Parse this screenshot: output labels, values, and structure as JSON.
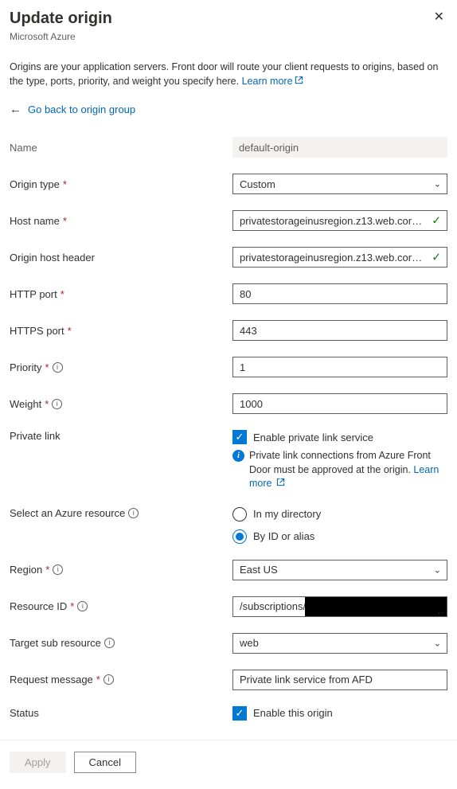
{
  "header": {
    "title": "Update origin",
    "subtitle": "Microsoft Azure"
  },
  "description": {
    "text": "Origins are your application servers. Front door will route your client requests to origins, based on the type, ports, priority, and weight you specify here.",
    "learn_more": "Learn more"
  },
  "back_link": "Go back to origin group",
  "fields": {
    "name": {
      "label": "Name",
      "value": "default-origin"
    },
    "origin_type": {
      "label": "Origin type",
      "value": "Custom"
    },
    "host_name": {
      "label": "Host name",
      "value": "privatestorageinusregion.z13.web.core.wind..."
    },
    "origin_host_header": {
      "label": "Origin host header",
      "value": "privatestorageinusregion.z13.web.core.wind..."
    },
    "http_port": {
      "label": "HTTP port",
      "value": "80"
    },
    "https_port": {
      "label": "HTTPS port",
      "value": "443"
    },
    "priority": {
      "label": "Priority",
      "value": "1"
    },
    "weight": {
      "label": "Weight",
      "value": "1000"
    },
    "private_link": {
      "label": "Private link",
      "checkbox_label": "Enable private link service",
      "note": "Private link connections from Azure Front Door must be approved at the origin.",
      "learn_more": "Learn more"
    },
    "select_resource": {
      "label": "Select an Azure resource",
      "option_a": "In my directory",
      "option_b": "By ID or alias"
    },
    "region": {
      "label": "Region",
      "value": "East US"
    },
    "resource_id": {
      "label": "Resource ID",
      "prefix": "/subscriptions/"
    },
    "target_sub_resource": {
      "label": "Target sub resource",
      "value": "web"
    },
    "request_message": {
      "label": "Request message",
      "value": "Private link service from AFD"
    },
    "status": {
      "label": "Status",
      "checkbox_label": "Enable this origin"
    }
  },
  "footer": {
    "apply": "Apply",
    "cancel": "Cancel"
  }
}
